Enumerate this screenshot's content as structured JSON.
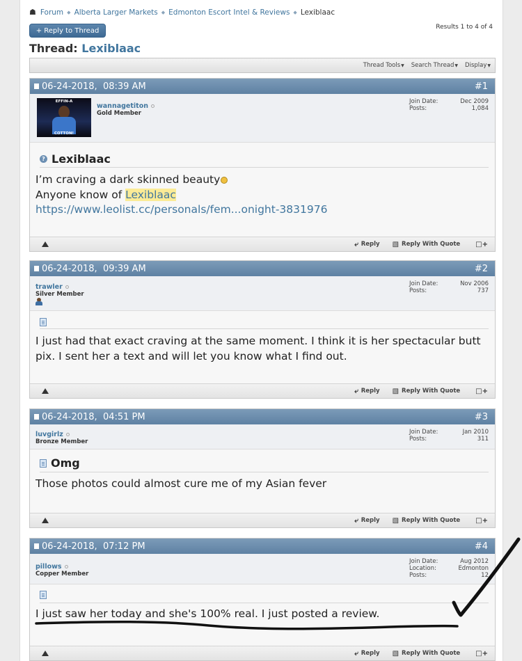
{
  "breadcrumb": {
    "items": [
      "Forum",
      "Alberta Larger Markets",
      "Edmonton Escort Intel & Reviews"
    ],
    "current": "Lexiblaac"
  },
  "reply_to_thread_label": "+ Reply to Thread",
  "results_text": "Results 1 to 4 of 4",
  "thread": {
    "prefix": "Thread:",
    "name": "Lexiblaac"
  },
  "toolbar": [
    "Thread Tools",
    "Search Thread",
    "Display"
  ],
  "footer_labels": {
    "reply": "Reply",
    "reply_with_quote": "Reply With Quote"
  },
  "stat_labels": {
    "join_date": "Join Date:",
    "posts": "Posts:",
    "location": "Location:"
  },
  "posts": [
    {
      "date": "06-24-2018,",
      "time": "08:39 AM",
      "number": "#1",
      "username": "wannagetiton",
      "usertitle": "Gold Member",
      "avatar_top_text": "EFFIN-A",
      "avatar_bottom_text": "COTTON!",
      "join_date": "Dec 2009",
      "posts": "1,084",
      "title": "Lexiblaac",
      "line1": "I’m craving a dark skinned beauty",
      "line2_prefix": "Anyone know of ",
      "line2_highlight": "Lexiblaac",
      "link": "https://www.leolist.cc/personals/fem...onight-3831976"
    },
    {
      "date": "06-24-2018,",
      "time": "09:39 AM",
      "number": "#2",
      "username": "trawler",
      "usertitle": "Silver Member",
      "join_date": "Nov 2006",
      "posts": "737",
      "message": "I just had that exact craving at the same moment. I think it is her spectacular butt pix. I sent her a text and will let you know what I find out."
    },
    {
      "date": "06-24-2018,",
      "time": "04:51 PM",
      "number": "#3",
      "username": "luvgirlz",
      "usertitle": "Bronze Member",
      "join_date": "Jan 2010",
      "posts": "311",
      "title": "Omg",
      "message": "Those photos could almost cure me of my Asian fever"
    },
    {
      "date": "06-24-2018,",
      "time": "07:12 PM",
      "number": "#4",
      "username": "pillows",
      "usertitle": "Copper Member",
      "join_date": "Aug 2012",
      "location": "Edmonton",
      "posts": "12",
      "message": "I just saw her today and she's 100% real. I just posted a review."
    }
  ]
}
